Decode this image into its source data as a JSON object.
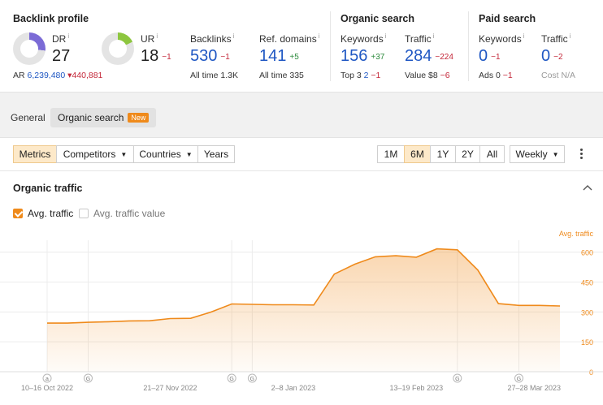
{
  "backlink_profile": {
    "title": "Backlink profile",
    "dr": {
      "label": "DR",
      "info": "i",
      "value": "27",
      "ring_color": "#7b6bd6",
      "ring_fraction": 0.27
    },
    "ar": {
      "label": "AR",
      "value": "6,239,480",
      "delta": "▾440,881"
    },
    "ur": {
      "label": "UR",
      "info": "i",
      "value": "18",
      "delta": "−1",
      "ring_color": "#8dc63f",
      "ring_fraction": 0.18
    },
    "backlinks": {
      "label": "Backlinks",
      "info": "i",
      "value": "530",
      "delta": "−1",
      "sub_label": "All time",
      "sub_value": "1.3K"
    },
    "ref_domains": {
      "label": "Ref. domains",
      "info": "i",
      "value": "141",
      "delta": "+5",
      "sub_label": "All time",
      "sub_value": "335"
    }
  },
  "organic_search": {
    "title": "Organic search",
    "keywords": {
      "label": "Keywords",
      "info": "i",
      "value": "156",
      "delta": "+37",
      "sub_label": "Top 3",
      "sub_value": "2",
      "sub_delta": "−1"
    },
    "traffic": {
      "label": "Traffic",
      "info": "i",
      "value": "284",
      "delta": "−224",
      "sub_label": "Value",
      "sub_value": "$8",
      "sub_delta": "−6"
    }
  },
  "paid_search": {
    "title": "Paid search",
    "keywords": {
      "label": "Keywords",
      "info": "i",
      "value": "0",
      "delta": "−1",
      "sub_label": "Ads",
      "sub_value": "0",
      "sub_delta": "−1"
    },
    "traffic": {
      "label": "Traffic",
      "info": "i",
      "value": "0",
      "delta": "−2",
      "sub_label": "Cost",
      "sub_value": "N/A"
    }
  },
  "tabs": {
    "general": "General",
    "organic": "Organic search",
    "new_badge": "New"
  },
  "toolbar": {
    "metrics": "Metrics",
    "competitors": "Competitors",
    "countries": "Countries",
    "years": "Years",
    "ranges": [
      "1M",
      "6M",
      "1Y",
      "2Y",
      "All"
    ],
    "selected_range": "6M",
    "interval": "Weekly"
  },
  "chart_section": {
    "title": "Organic traffic",
    "check_avg_traffic": "Avg. traffic",
    "check_avg_traffic_value": "Avg. traffic value",
    "accent_color": "#ef8a1b"
  },
  "chart_data": {
    "type": "area",
    "series": [
      {
        "name": "Avg. traffic",
        "values": [
          244,
          244,
          248,
          251,
          255,
          256,
          267,
          268,
          300,
          340,
          338,
          336,
          336,
          335,
          490,
          540,
          577,
          582,
          575,
          617,
          612,
          510,
          342,
          333,
          333,
          330
        ]
      }
    ],
    "y_axis_title": "Avg. traffic",
    "ylim": [
      0,
      660
    ],
    "yticks": [
      "0",
      "150",
      "300",
      "450",
      "600"
    ],
    "ytick_values": [
      0,
      150,
      300,
      450,
      600
    ],
    "x_tick_labels": [
      "10–16 Oct 2022",
      "21–27 Nov 2022",
      "2–8 Jan 2023",
      "13–19 Feb 2023",
      "27–28 Mar 2023"
    ],
    "x_tick_indices": [
      0,
      6,
      12,
      18,
      25
    ],
    "annotation_markers": [
      {
        "index": 0,
        "letter": "a"
      },
      {
        "index": 2,
        "letter": "G"
      },
      {
        "index": 9,
        "letter": "G"
      },
      {
        "index": 10,
        "letter": "G"
      },
      {
        "index": 20,
        "letter": "G"
      },
      {
        "index": 23,
        "letter": "G"
      }
    ],
    "grid": true,
    "legend": "none"
  }
}
